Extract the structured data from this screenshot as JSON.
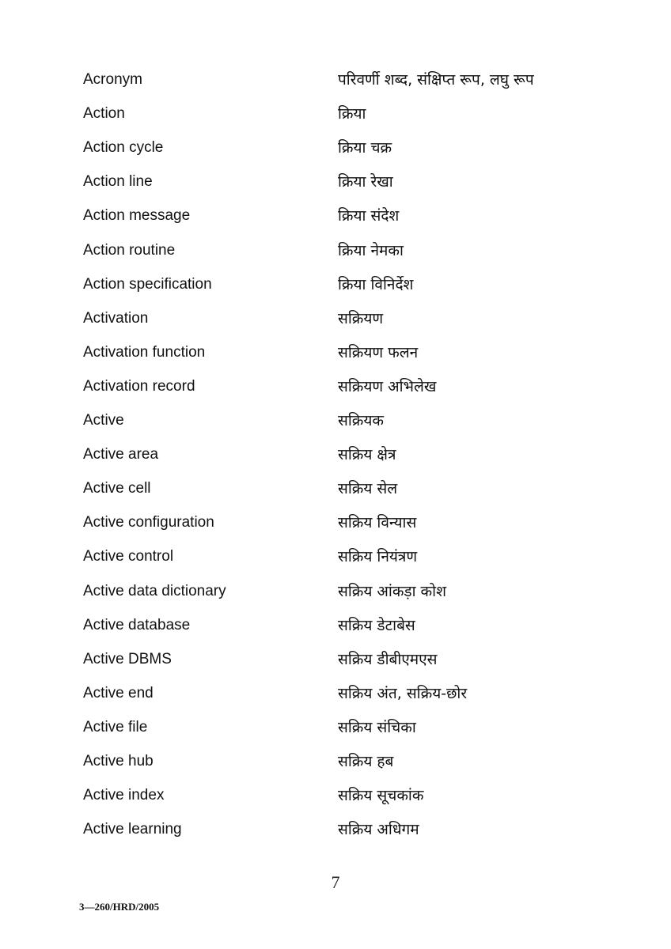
{
  "entries": [
    {
      "term": "Acronym",
      "hindi": "परिवर्णी शब्द, संक्षिप्त रूप, लघु रूप"
    },
    {
      "term": "Action",
      "hindi": "क्रिया"
    },
    {
      "term": "Action cycle",
      "hindi": "क्रिया चक्र"
    },
    {
      "term": "Action line",
      "hindi": "क्रिया रेखा"
    },
    {
      "term": "Action message",
      "hindi": "क्रिया संदेश"
    },
    {
      "term": "Action routine",
      "hindi": "क्रिया नेमका"
    },
    {
      "term": "Action specification",
      "hindi": "क्रिया विनिर्देश"
    },
    {
      "term": "Activation",
      "hindi": "सक्रियण"
    },
    {
      "term": "Activation function",
      "hindi": "सक्रियण फलन"
    },
    {
      "term": "Activation record",
      "hindi": "सक्रियण अभिलेख"
    },
    {
      "term": "Active",
      "hindi": "सक्रियक"
    },
    {
      "term": "Active area",
      "hindi": "सक्रिय क्षेत्र"
    },
    {
      "term": "Active cell",
      "hindi": "सक्रिय सेल"
    },
    {
      "term": "Active configuration",
      "hindi": "सक्रिय विन्यास"
    },
    {
      "term": "Active control",
      "hindi": "सक्रिय नियंत्रण"
    },
    {
      "term": "Active data dictionary",
      "hindi": "सक्रिय आंकड़ा कोश"
    },
    {
      "term": "Active database",
      "hindi": "सक्रिय डेटाबेस"
    },
    {
      "term": "Active DBMS",
      "hindi": "सक्रिय डीबीएमएस"
    },
    {
      "term": "Active end",
      "hindi": "सक्रिय अंत, सक्रिय-छोर"
    },
    {
      "term": "Active file",
      "hindi": "सक्रिय संचिका"
    },
    {
      "term": "Active hub",
      "hindi": "सक्रिय हब"
    },
    {
      "term": "Active index",
      "hindi": "सक्रिय सूचकांक"
    },
    {
      "term": "Active learning",
      "hindi": "सक्रिय अधिगम"
    }
  ],
  "page_number": "7",
  "footer_code": "3—260/HRD/2005"
}
